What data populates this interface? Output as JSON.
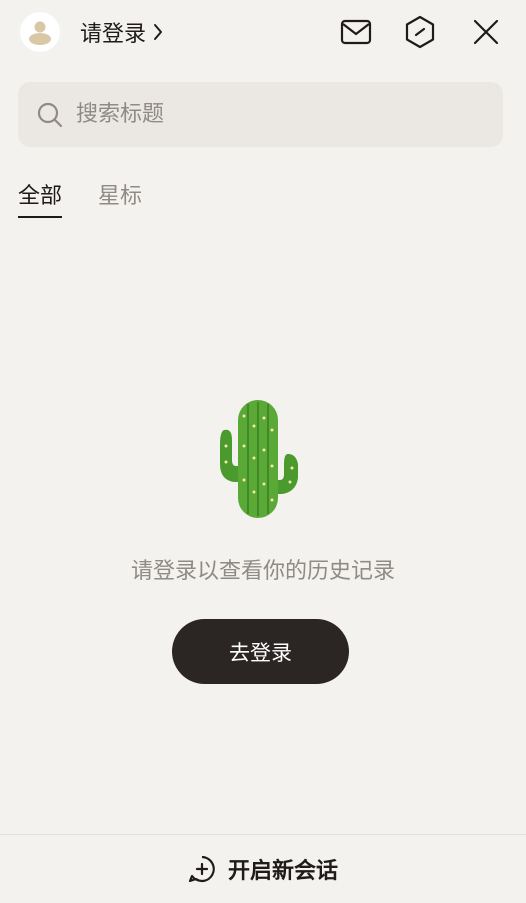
{
  "header": {
    "login_label": "请登录",
    "icons": [
      "avatar-user-icon",
      "chevron-right-icon",
      "mail-icon",
      "hexagon-slash-icon",
      "close-icon"
    ]
  },
  "search": {
    "placeholder": "搜索标题",
    "icon": "search-icon"
  },
  "tabs": [
    {
      "label": "全部",
      "active": true
    },
    {
      "label": "星标",
      "active": false
    }
  ],
  "empty_state": {
    "illustration": "cactus-icon",
    "message": "请登录以查看你的历史记录",
    "button_label": "去登录"
  },
  "footer": {
    "new_chat_label": "开启新会话",
    "icon": "plus-circle-chat-icon"
  },
  "colors": {
    "background": "#f4f2ef",
    "search_bg": "#ebe8e4",
    "primary_button": "#2b2524",
    "muted_text": "#8f8a86",
    "text": "#1f1b1a"
  }
}
